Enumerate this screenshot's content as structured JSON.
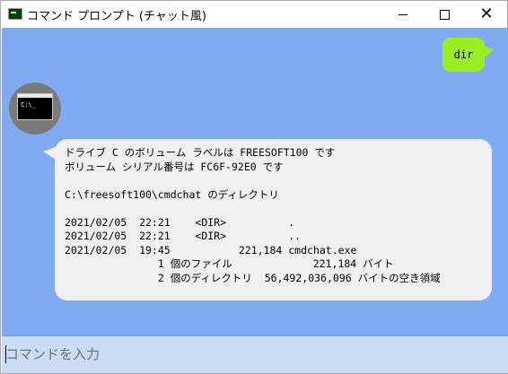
{
  "window": {
    "title": "コマンド プロンプト (チャット風)",
    "controls": {
      "minimize_icon": "minimize-icon",
      "maximize_icon": "maximize-icon",
      "close_icon": "close-icon"
    }
  },
  "chat": {
    "background": "#80aaf2",
    "user_message": {
      "text": "dir",
      "color": "#99ee22"
    },
    "bot_avatar": {
      "icon": "terminal-icon",
      "prompt": "C:\\_"
    },
    "bot_message": {
      "color": "#f0f0f0",
      "lines": [
        "ドライブ C のボリューム ラベルは FREESOFT100 です",
        "ボリューム シリアル番号は FC6F-92E0 です",
        "",
        "C:\\freesoft100\\cmdchat のディレクトリ",
        "",
        "2021/02/05  22:21    <DIR>          .",
        "2021/02/05  22:21    <DIR>          ..",
        "2021/02/05  19:45           221,184 cmdchat.exe",
        "               1 個のファイル             221,184 バイト",
        "               2 個のディレクトリ  56,492,036,096 バイトの空き領域"
      ]
    }
  },
  "input": {
    "placeholder": "コマンドを入力",
    "value": ""
  }
}
